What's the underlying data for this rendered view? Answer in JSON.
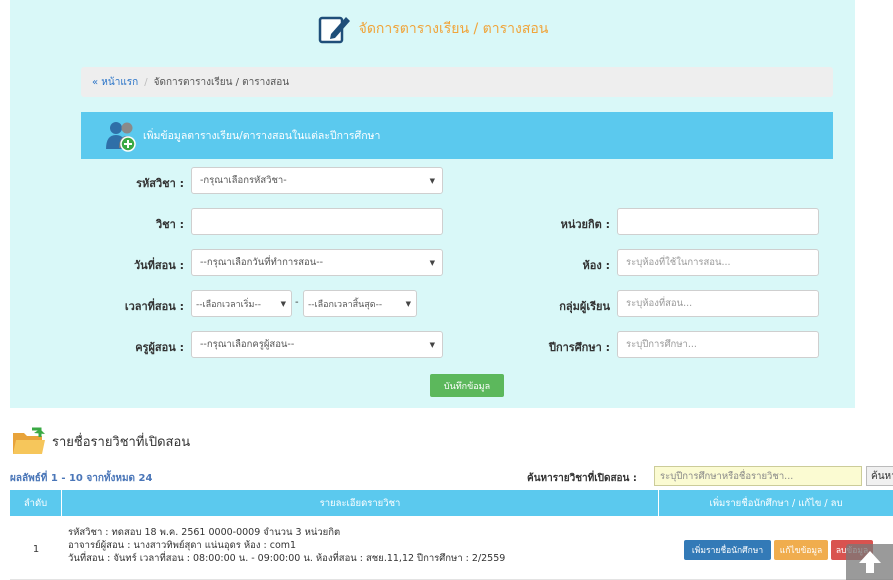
{
  "header": {
    "title": "จัดการตารางเรียน / ตารางสอน",
    "icon": "edit-icon"
  },
  "breadcrumb": {
    "home": "« หน้าแรก",
    "separator": "/",
    "current": "จัดการตารางเรียน / ตารางสอน"
  },
  "form": {
    "title": "เพิ่มข้อมูลตารางเรียน/ตารางสอนในแต่ละปีการศึกษา",
    "icon": "add-users-icon",
    "subject_code": {
      "label": "รหัสวิชา :",
      "value": "-กรุณาเลือกรหัสวิชา-"
    },
    "subject": {
      "label": "วิชา :",
      "value": ""
    },
    "credits": {
      "label": "หน่วยกิต :",
      "value": ""
    },
    "day": {
      "label": "วันที่สอน :",
      "value": "--กรุณาเลือกวันที่ทำการสอน--"
    },
    "room": {
      "label": "ห้อง :",
      "placeholder": "ระบุห้องที่ใช้ในการสอน..."
    },
    "time": {
      "label": "เวลาที่สอน :",
      "start": "--เลือกเวลาเริ่ม--",
      "dash": "-",
      "end": "--เลือกเวลาสิ้นสุด--"
    },
    "study_group": {
      "label": "กลุ่มผู้เรียน",
      "placeholder": "ระบุห้องที่สอน..."
    },
    "teacher": {
      "label": "ครูผู้สอน :",
      "value": "--กรุณาเลือกครูผู้สอน--"
    },
    "academic_year": {
      "label": "ปีการศึกษา :",
      "placeholder": "ระบุปีการศึกษา..."
    },
    "save_button": "บันทึกข้อมูล"
  },
  "list": {
    "title": "รายชื่อรายวิชาที่เปิดสอน",
    "icon": "folder-icon",
    "result_info": "ผลลัพธ์ที่ 1 - 10 จากทั้งหมด 24",
    "search_label": "ค้นหารายวิชาที่เปิดสอน :",
    "search_placeholder": "ระบุปีการศึกษาหรือชื่อรายวิชา...",
    "search_button": "ค้นหา",
    "columns": [
      "ลำดับ",
      "รายละเอียดรายวิชา",
      "เพิ่มรายชื่อนักศึกษา / แก้ไข / ลบ"
    ],
    "rows": [
      {
        "no": "1",
        "line1": "รหัสวิชา : ทดสอบ 18 พ.ค. 2561   0000-0009 จำนวน 3 หน่วยกิต",
        "line2": "อาจารย์ผู้สอน : นางสาวทิพย์สุดา แน่นอุดร ห้อง : com1",
        "line3": "วันที่สอน : จันทร์   เวลาที่สอน : 08:00:00 น. - 09:00:00 น. ห้องที่สอน : สชย.11,12   ปีการศึกษา : 2/2559",
        "add_button": "เพิ่มรายชื่อนักศึกษา",
        "edit_button": "แก้ไขข้อมูล",
        "delete_button": "ลบข้อมูล"
      }
    ]
  },
  "scroll_top": {
    "icon": "arrow-up-icon"
  },
  "colors": {
    "panel_bg": "#d9f8f8",
    "title_orange": "#f0a43a",
    "card_blue": "#5bc9ee",
    "save_green": "#5cb85c",
    "btn_blue": "#337ab7",
    "btn_orange": "#f0ad4e",
    "btn_red": "#d9534f"
  }
}
